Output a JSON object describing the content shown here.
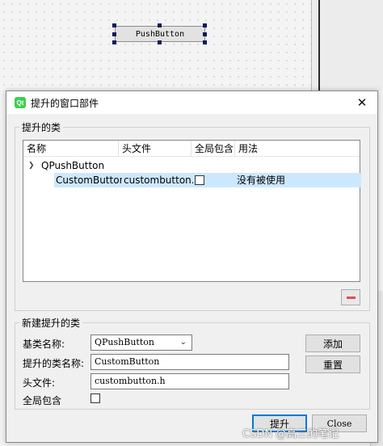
{
  "designer": {
    "widget_label": "PushButton"
  },
  "dialog": {
    "title": "提升的窗口部件",
    "close_icon": "close-icon",
    "promoted_classes": {
      "group_title": "提升的类",
      "headers": [
        "名称",
        "头文件",
        "全局包含",
        "用法"
      ],
      "base_class_node": "QPushButton",
      "rows": [
        {
          "name": "CustomButton",
          "header": "custombutton.h",
          "global_include": false,
          "usage": "没有被使用"
        }
      ]
    },
    "new_class": {
      "group_title": "新建提升的类",
      "base_class_label": "基类名称:",
      "base_class_value": "QPushButton",
      "class_name_label": "提升的类名称:",
      "class_name_value": "CustomButton",
      "header_label": "头文件:",
      "header_value": "custombutton.h",
      "global_include_label": "全局包含",
      "add_button": "添加",
      "reset_button": "重置"
    },
    "promote_button": "提升",
    "close_button": "Close"
  },
  "watermark": "CSDN @高三的笔记"
}
